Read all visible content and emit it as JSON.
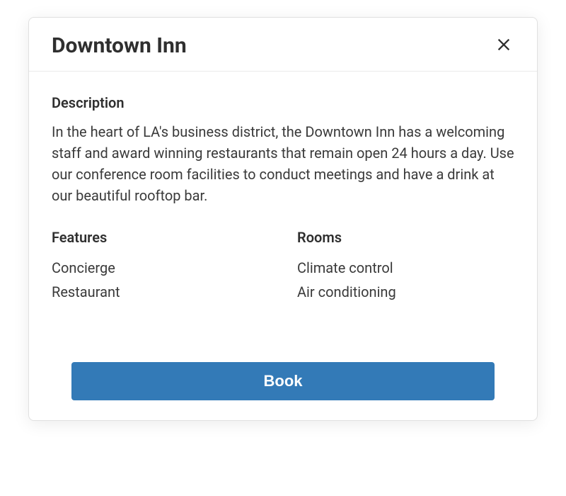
{
  "modal": {
    "title": "Downtown Inn",
    "description_heading": "Description",
    "description_text": "In the heart of LA's business district, the Downtown Inn has a welcoming staff and award winning restaurants that remain open 24 hours a day. Use our conference room facilities to conduct meetings and have a drink at our beautiful rooftop bar.",
    "features_heading": "Features",
    "features": [
      "Concierge",
      "Restaurant"
    ],
    "rooms_heading": "Rooms",
    "rooms": [
      "Climate control",
      "Air conditioning"
    ],
    "book_label": "Book"
  }
}
